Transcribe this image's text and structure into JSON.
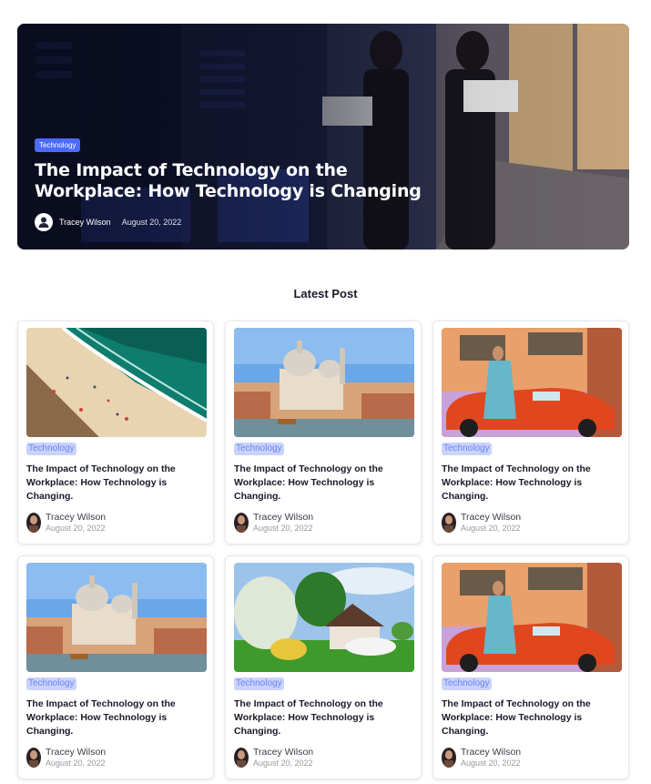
{
  "hero": {
    "tag": "Technology",
    "title": "The Impact of Technology on the Workplace: How Technology is Changing",
    "author": "Tracey Wilson",
    "date": "August 20, 2022",
    "avatar_icon": "user-icon"
  },
  "section": {
    "title": "Latest Post"
  },
  "colors": {
    "accent": "#4b6bfb",
    "tag_bg": "#c9d3fb",
    "tag_text": "#6b84f6"
  },
  "cards": [
    {
      "image": "beach-aerial",
      "tag": "Technology",
      "title": "The Impact of Technology on the Workplace: How Technology is Changing.",
      "author": "Tracey Wilson",
      "date": "August 20, 2022"
    },
    {
      "image": "venice-cathedral",
      "tag": "Technology",
      "title": "The Impact of Technology on the Workplace: How Technology is Changing.",
      "author": "Tracey Wilson",
      "date": "August 20, 2022"
    },
    {
      "image": "woman-red-car",
      "tag": "Technology",
      "title": "The Impact of Technology on the Workplace: How Technology is Changing.",
      "author": "Tracey Wilson",
      "date": "August 20, 2022"
    },
    {
      "image": "venice-cathedral",
      "tag": "Technology",
      "title": "The Impact of Technology on the Workplace: How Technology is Changing.",
      "author": "Tracey Wilson",
      "date": "August 20, 2022"
    },
    {
      "image": "countryside-house",
      "tag": "Technology",
      "title": "The Impact of Technology on the Workplace: How Technology is Changing.",
      "author": "Tracey Wilson",
      "date": "August 20, 2022"
    },
    {
      "image": "woman-red-car",
      "tag": "Technology",
      "title": "The Impact of Technology on the Workplace: How Technology is Changing.",
      "author": "Tracey Wilson",
      "date": "August 20, 2022"
    }
  ]
}
